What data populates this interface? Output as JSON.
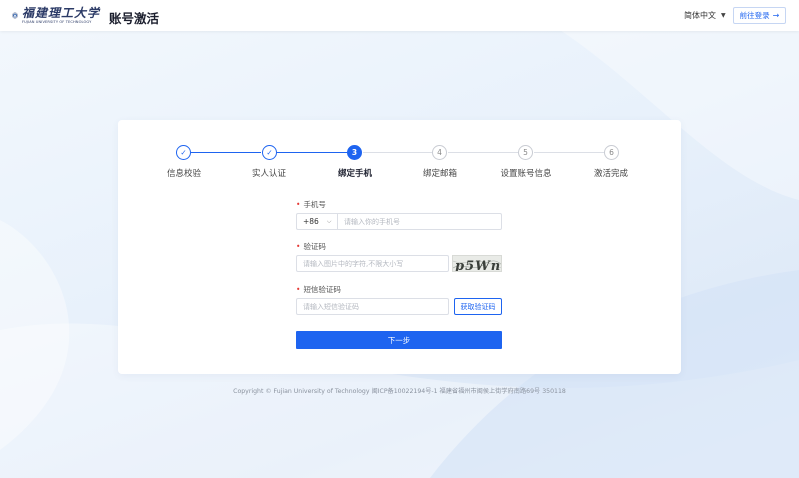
{
  "header": {
    "logo_cn": "福建理工大学",
    "logo_en": "FUJIAN UNIVERSITY OF TECHNOLOGY",
    "title": "账号激活",
    "language": "简体中文",
    "login_label": "前往登录"
  },
  "steps": [
    {
      "num": "✓",
      "label": "信息校验",
      "state": "done"
    },
    {
      "num": "✓",
      "label": "实人认证",
      "state": "done"
    },
    {
      "num": "3",
      "label": "绑定手机",
      "state": "active"
    },
    {
      "num": "4",
      "label": "绑定邮箱",
      "state": "todo"
    },
    {
      "num": "5",
      "label": "设置账号信息",
      "state": "todo"
    },
    {
      "num": "6",
      "label": "激活完成",
      "state": "todo"
    }
  ],
  "form": {
    "phone_label": "手机号",
    "phone_prefix": "+86",
    "phone_placeholder": "请输入你的手机号",
    "captcha_label": "验证码",
    "captcha_placeholder": "请输入图片中的字符,不限大小写",
    "captcha_text": "p5Wn",
    "sms_label": "短信验证码",
    "sms_placeholder": "请输入短信验证码",
    "sms_button": "获取验证码",
    "next_button": "下一步"
  },
  "footer": {
    "copyright": "Copyright © Fujian University of Technology 闽ICP备10022194号-1 福建省福州市闽侯上街学府南路69号 350118"
  },
  "colors": {
    "accent": "#1e64f0",
    "required": "#e53935"
  }
}
